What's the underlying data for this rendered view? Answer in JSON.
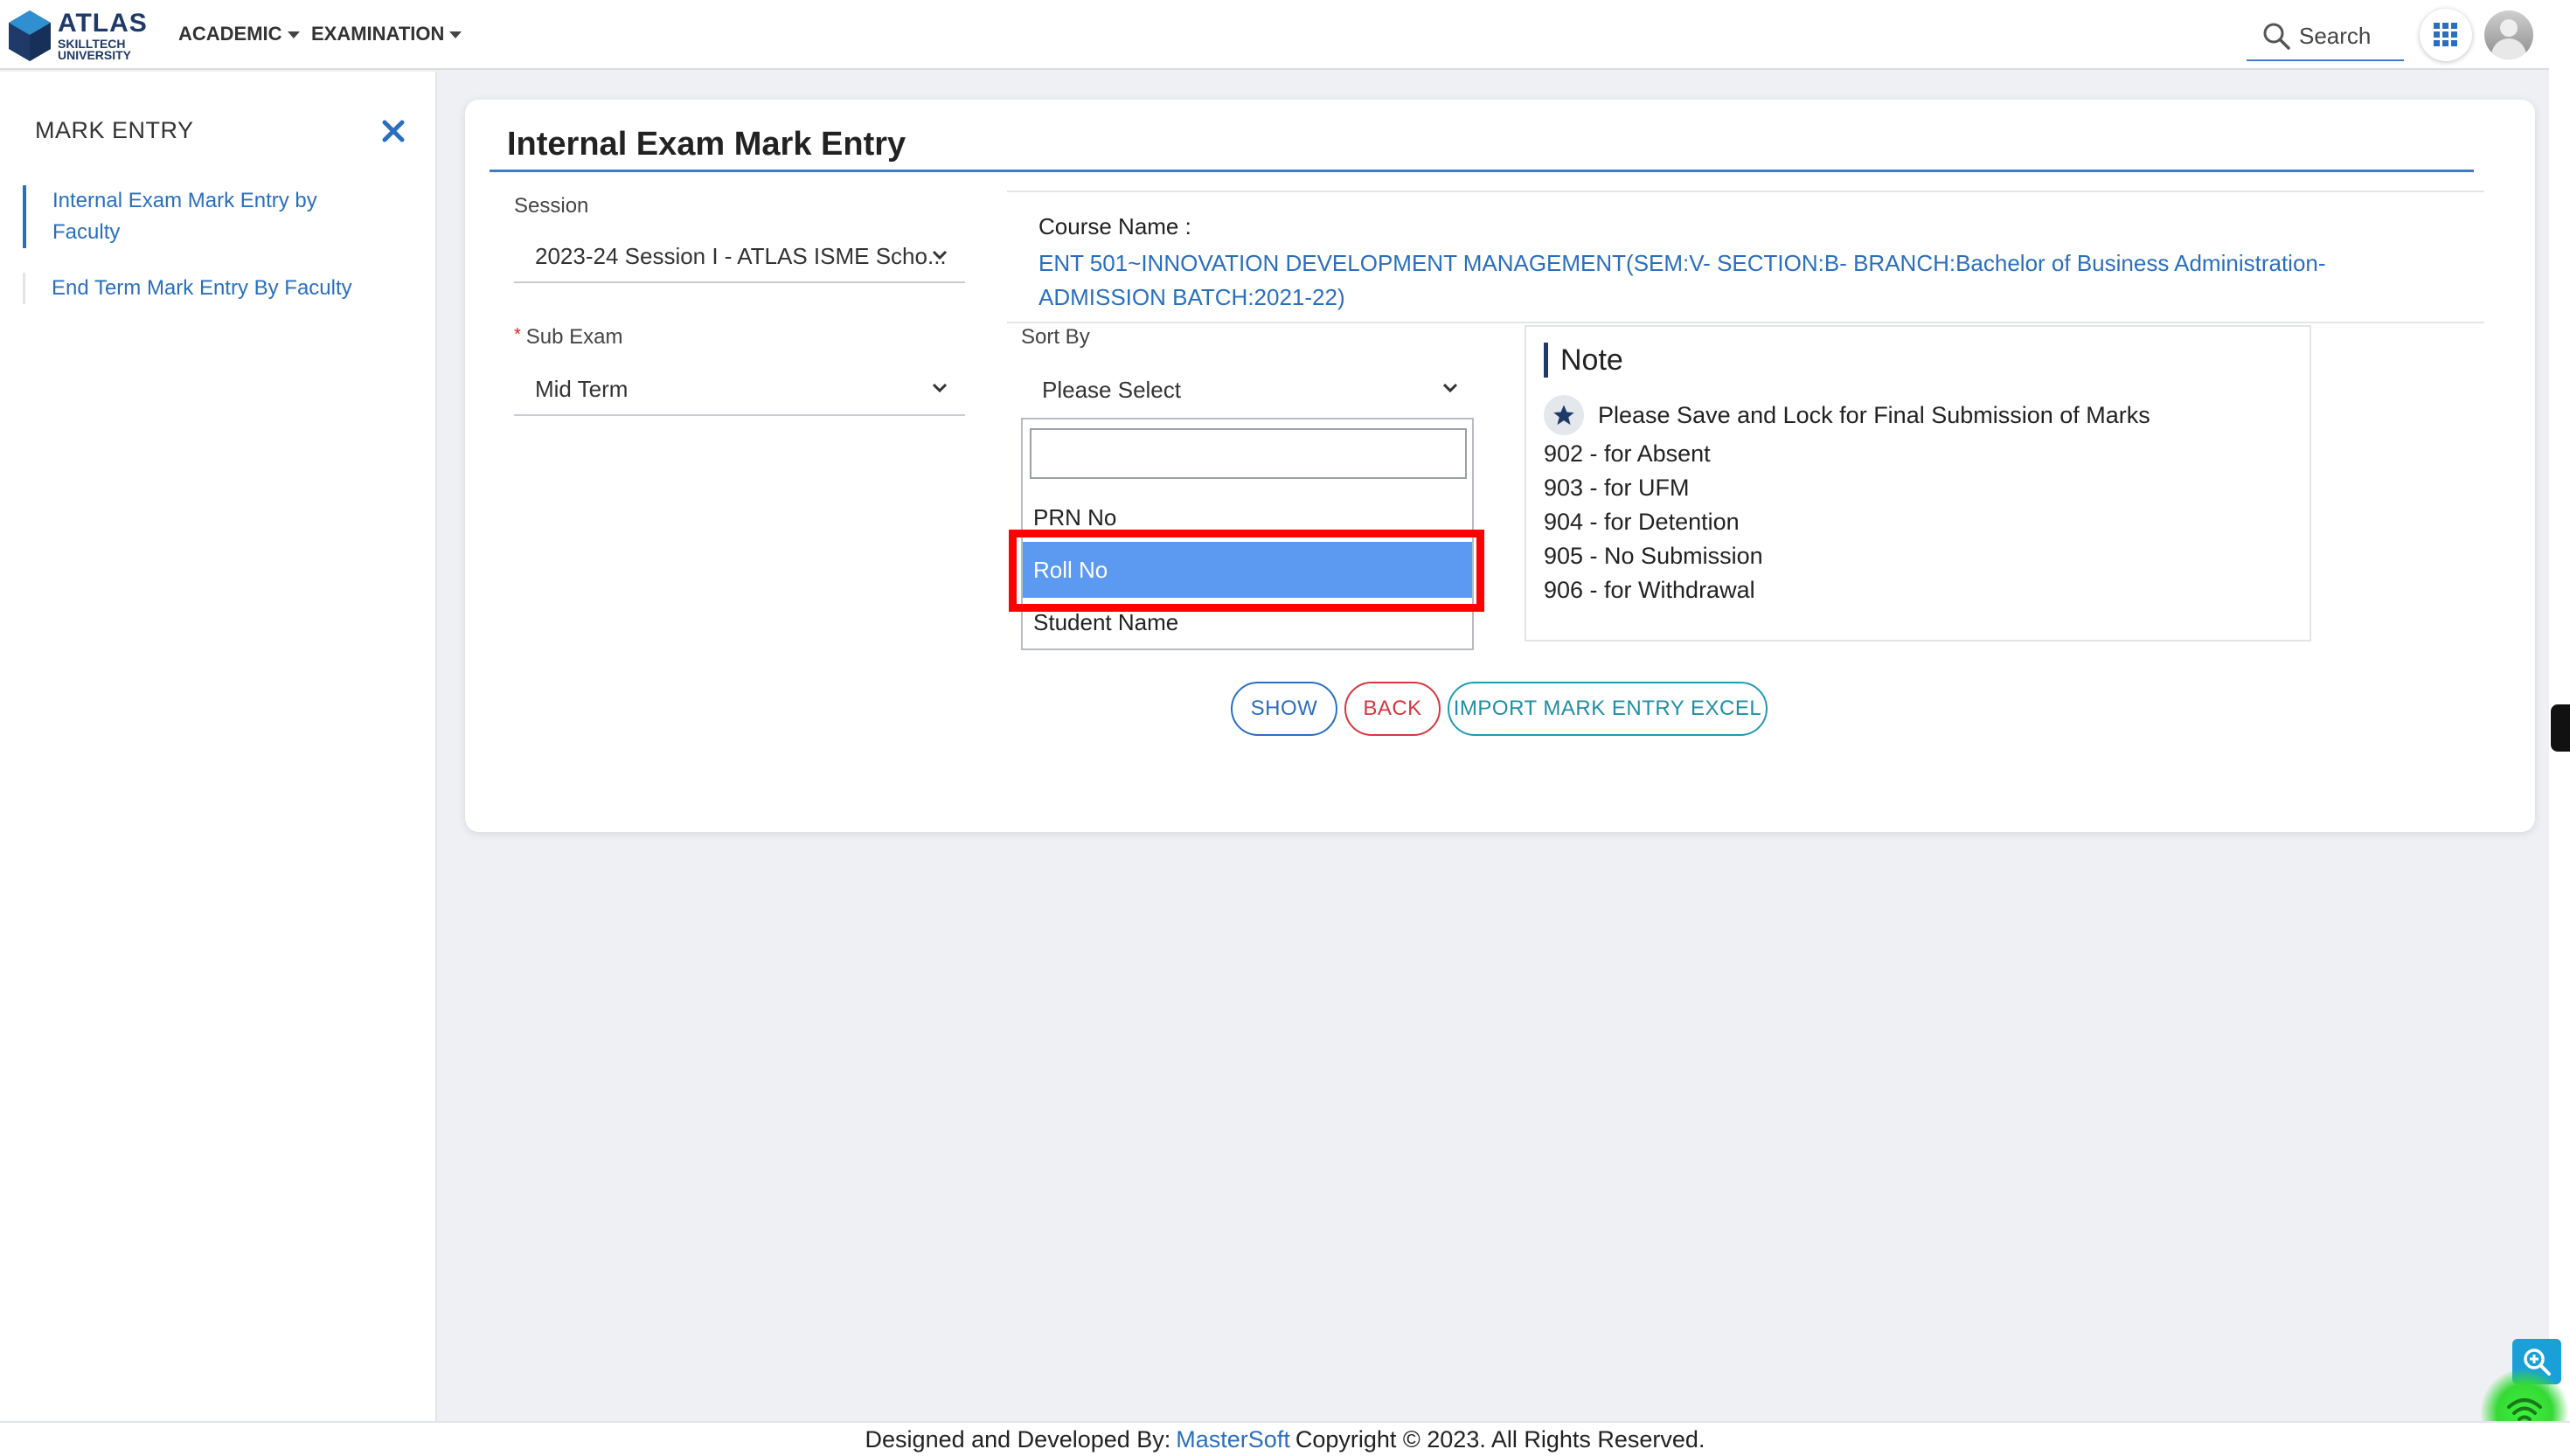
{
  "header": {
    "logo_title": "ATLAS",
    "logo_subtitle_line1": "SKILLTECH",
    "logo_subtitle_line2": "UNIVERSITY",
    "nav": [
      {
        "label": "ACADEMIC"
      },
      {
        "label": "EXAMINATION"
      }
    ],
    "search_label": "Search",
    "icons": [
      "apps-grid-icon",
      "user-avatar"
    ]
  },
  "sidebar": {
    "title": "MARK ENTRY",
    "items": [
      {
        "label": "Internal Exam Mark Entry by Faculty",
        "active": true
      },
      {
        "label": "End Term Mark Entry By Faculty",
        "active": false
      }
    ]
  },
  "main": {
    "title": "Internal Exam Mark Entry",
    "session": {
      "label": "Session",
      "value": "2023-24 Session I - ATLAS ISME Scho..."
    },
    "course": {
      "label": "Course Name :",
      "value": "ENT 501~INNOVATION DEVELOPMENT MANAGEMENT(SEM:V- SECTION:B- BRANCH:Bachelor of Business Administration- ADMISSION BATCH:2021-22)"
    },
    "sub_exam": {
      "label": "Sub Exam",
      "required_mark": "*",
      "value": "Mid Term"
    },
    "sort_by": {
      "label": "Sort By",
      "value": "Please Select",
      "search_value": "",
      "options": [
        "PRN No",
        "Roll No",
        "Student Name"
      ],
      "highlighted_option": "Roll No"
    },
    "note": {
      "title": "Note",
      "starred_text": "Please Save and Lock for Final Submission of Marks",
      "lines": [
        "902 - for Absent",
        "903 - for UFM",
        "904 - for Detention",
        "905 - No Submission",
        "906 - for Withdrawal"
      ]
    },
    "buttons": {
      "show": "SHOW",
      "back": "BACK",
      "import": "IMPORT MARK ENTRY EXCEL"
    }
  },
  "footer": {
    "prefix": "Designed and Developed By:",
    "link": "MasterSoft",
    "suffix": "Copyright © 2023. All Rights Reserved."
  },
  "colors": {
    "accent_blue": "#2a6fbe",
    "selected_option": "#5b9af0",
    "highlight_box": "#ff0000",
    "back_red": "#d9363e",
    "import_teal": "#1f9bb0"
  }
}
